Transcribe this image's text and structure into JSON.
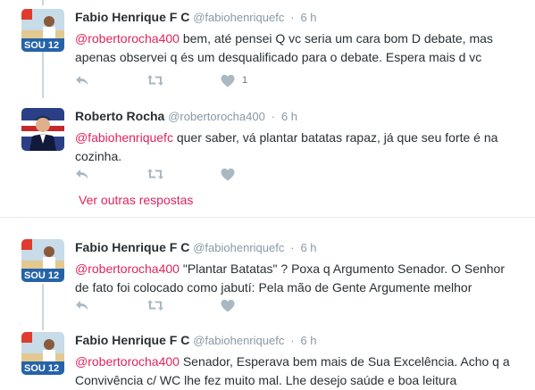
{
  "tweets": [
    {
      "name": "Fabio Henrique F C",
      "handle": "@fabiohenriquefc",
      "dot": "·",
      "time": "6 h",
      "mention": "@robertorocha400",
      "line1": " bem, até pensei Q vc seria um cara bom D debate, mas",
      "line2": "apenas observei q és um desqualificado para o debate. Espera mais d vc",
      "like_count": "1",
      "avatar_badge": "SOU 12"
    },
    {
      "name": "Roberto Rocha",
      "handle": "@robertorocha400",
      "dot": "·",
      "time": "6 h",
      "mention": "@fabiohenriquefc",
      "line1": " quer saber, vá plantar batatas rapaz, já que seu forte é na",
      "line2": "cozinha.",
      "like_count": ""
    },
    {
      "name": "Fabio Henrique F C",
      "handle": "@fabiohenriquefc",
      "dot": "·",
      "time": "6 h",
      "mention": "@robertorocha400",
      "line1": " \"Plantar Batatas\" ? Poxa q Argumento Senador. O Senhor",
      "line2": "de fato foi colocado como jabutí: Pela mão de Gente Argumente melhor",
      "like_count": "",
      "avatar_badge": "SOU 12"
    },
    {
      "name": "Fabio Henrique F C",
      "handle": "@fabiohenriquefc",
      "dot": "·",
      "time": "6 h",
      "mention": "@robertorocha400",
      "line1": " Senador, Esperava bem mais de Sua Excelência. Acho q a",
      "line2": "Convivência c/ WC lhe fez muito mal. Lhe desejo saúde e boa leitura",
      "avatar_badge": "SOU 12"
    }
  ],
  "more_replies": "Ver outras respostas",
  "colors": {
    "accent": "#e0245e",
    "muted": "#8899a6",
    "icon": "#aab8c2"
  },
  "icons": [
    "reply-icon",
    "retweet-icon",
    "like-icon"
  ]
}
